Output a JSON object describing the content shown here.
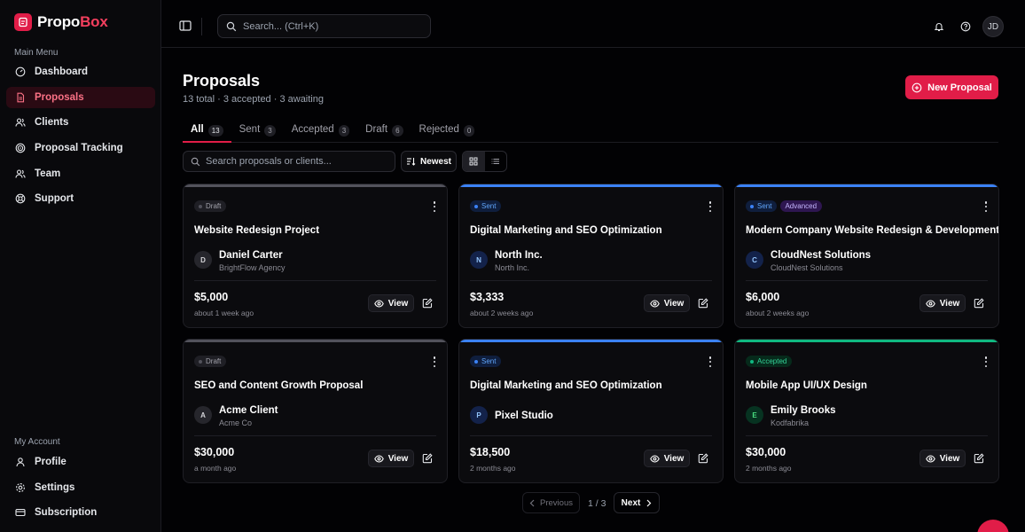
{
  "app": {
    "logo_part1": "Propo",
    "logo_part2": "Box",
    "brand_color": "#e11d48"
  },
  "sidebar": {
    "main_menu_label": "Main Menu",
    "items": [
      {
        "label": "Dashboard",
        "icon": "dashboard-icon",
        "active": false
      },
      {
        "label": "Proposals",
        "icon": "document-icon",
        "active": true
      },
      {
        "label": "Clients",
        "icon": "users-icon",
        "active": false
      },
      {
        "label": "Proposal Tracking",
        "icon": "radar-icon",
        "active": false
      },
      {
        "label": "Team",
        "icon": "team-icon",
        "active": false
      },
      {
        "label": "Support",
        "icon": "lifebuoy-icon",
        "active": false
      }
    ],
    "account_label": "My Account",
    "account_items": [
      {
        "label": "Profile",
        "icon": "user-icon"
      },
      {
        "label": "Settings",
        "icon": "gear-icon"
      },
      {
        "label": "Subscription",
        "icon": "credit-card-icon"
      }
    ]
  },
  "topbar": {
    "search_placeholder": "Search... (Ctrl+K)",
    "avatar_initials": "JD"
  },
  "page": {
    "title": "Proposals",
    "subtitle": "13 total · 3 accepted · 3 awaiting",
    "new_button": "New Proposal"
  },
  "tabs": [
    {
      "label": "All",
      "count": "13",
      "active": true
    },
    {
      "label": "Sent",
      "count": "3",
      "active": false
    },
    {
      "label": "Accepted",
      "count": "3",
      "active": false
    },
    {
      "label": "Draft",
      "count": "6",
      "active": false
    },
    {
      "label": "Rejected",
      "count": "0",
      "active": false
    }
  ],
  "filters": {
    "search_placeholder": "Search proposals or clients...",
    "sort_label": "Newest"
  },
  "cards": [
    {
      "status": "Draft",
      "extra_badge": "",
      "title": "Website Redesign Project",
      "client_initial": "D",
      "client_name": "Daniel Carter",
      "client_org": "BrightFlow Agency",
      "amount": "$5,000",
      "ago": "about 1 week ago",
      "view_label": "View"
    },
    {
      "status": "Sent",
      "extra_badge": "",
      "title": "Digital Marketing and SEO Optimization",
      "client_initial": "N",
      "client_name": "North Inc.",
      "client_org": "North Inc.",
      "amount": "$3,333",
      "ago": "about 2 weeks ago",
      "view_label": "View"
    },
    {
      "status": "Sent",
      "extra_badge": "Advanced",
      "title": "Modern Company Website Redesign & Development",
      "client_initial": "C",
      "client_name": "CloudNest Solutions",
      "client_org": "CloudNest Solutions",
      "amount": "$6,000",
      "ago": "about 2 weeks ago",
      "view_label": "View"
    },
    {
      "status": "Draft",
      "extra_badge": "",
      "title": "SEO and Content Growth Proposal",
      "client_initial": "A",
      "client_name": "Acme Client",
      "client_org": "Acme Co",
      "amount": "$30,000",
      "ago": "a month ago",
      "view_label": "View"
    },
    {
      "status": "Sent",
      "extra_badge": "",
      "title": "Digital Marketing and SEO Optimization",
      "client_initial": "P",
      "client_name": "Pixel Studio",
      "client_org": "",
      "amount": "$18,500",
      "ago": "2 months ago",
      "view_label": "View"
    },
    {
      "status": "Accepted",
      "extra_badge": "",
      "title": "Mobile App UI/UX Design",
      "client_initial": "E",
      "client_name": "Emily Brooks",
      "client_org": "Kodfabrika",
      "amount": "$30,000",
      "ago": "2 months ago",
      "view_label": "View"
    }
  ],
  "status_colors": {
    "Draft": "#52525b",
    "Sent": "#3b82f6",
    "Accepted": "#10b981"
  },
  "pagination": {
    "prev_label": "Previous",
    "page_info": "1 / 3",
    "next_label": "Next"
  }
}
